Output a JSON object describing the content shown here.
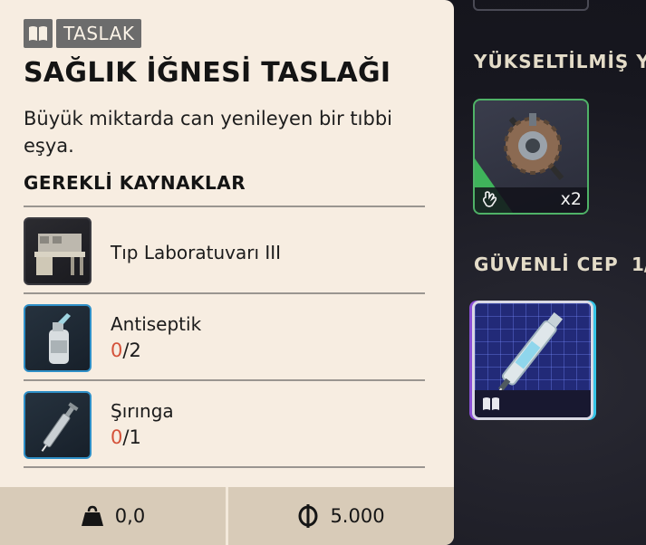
{
  "tooltip": {
    "badge_label": "TASLAK",
    "badge_icon": "book-icon",
    "title": "SAĞLIK İĞNESİ TASLAĞI",
    "description": "Büyük miktarda can yenileyen bir tıbbi eşya.",
    "requirements_title": "GEREKLİ KAYNAKLAR",
    "requirements": [
      {
        "name": "Tıp Laboratuvarı III",
        "icon": "lab-bench-icon",
        "have": null,
        "need": null
      },
      {
        "name": "Antiseptik",
        "icon": "antiseptic-bottle-icon",
        "have": "0",
        "need": "/2"
      },
      {
        "name": "Şırınga",
        "icon": "syringe-icon",
        "have": "0",
        "need": "/1"
      }
    ],
    "footer": {
      "weight_icon": "weight-icon",
      "weight": "0,0",
      "price_icon": "currency-icon",
      "price": "5.000"
    }
  },
  "inventory": {
    "upgraded_section_title": "YÜKSELTİLMİŞ YU",
    "upgraded_item": {
      "icon": "gear-device-icon",
      "quantity": "x2",
      "hand_icon": "hand-icon"
    },
    "safe_pocket_title": "GÜVENLİ CEP",
    "safe_pocket_count": "1/",
    "safe_pocket_item": {
      "icon": "syringe-blueprint-icon",
      "type_icon": "book-icon"
    }
  },
  "colors": {
    "panel_bg": "#f7ede1",
    "badge_bg": "#6c6c6c",
    "missing_count": "#d4523a",
    "upgraded_accent": "#3fb35b",
    "blueprint_bg": "#222a78"
  }
}
